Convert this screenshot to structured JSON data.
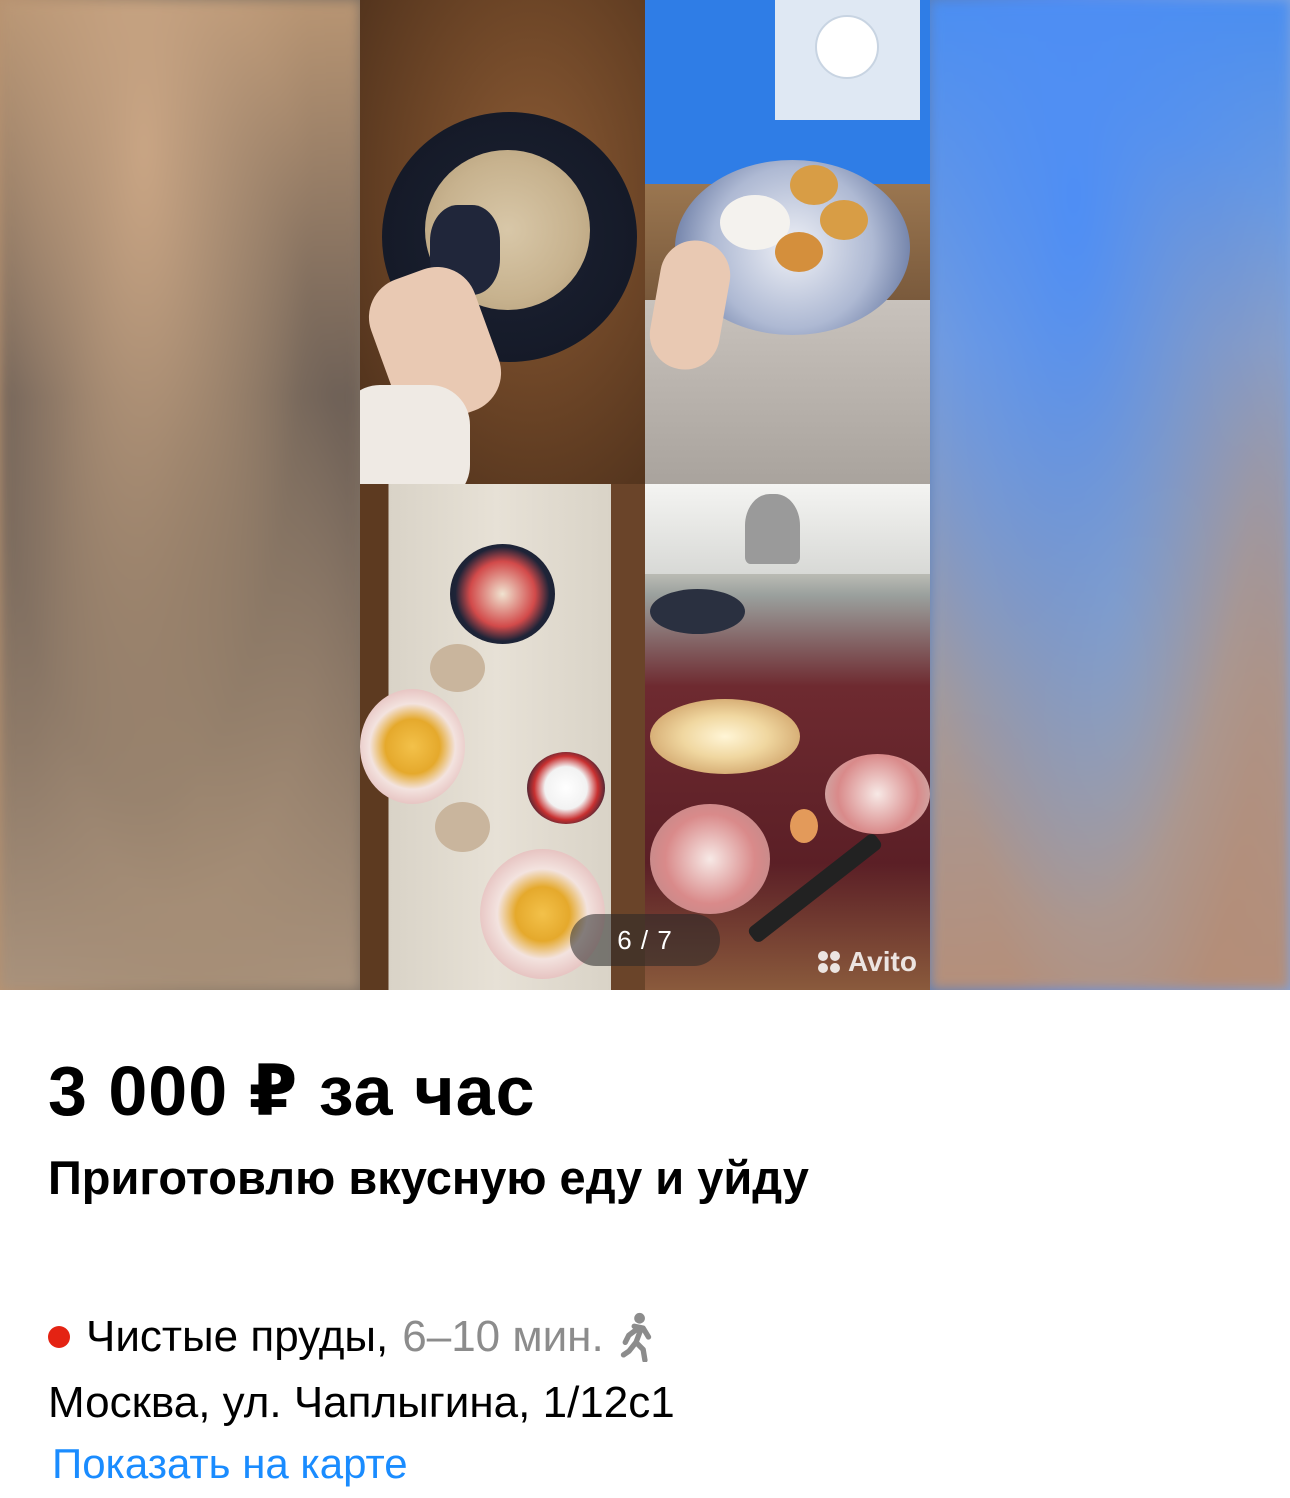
{
  "gallery": {
    "counter": "6 / 7",
    "watermark": "Avito"
  },
  "listing": {
    "price": "3 000 ₽ за час",
    "title": "Приготовлю вкусную еду и уйду"
  },
  "location": {
    "metro_station": "Чистые пруды,",
    "metro_time": "6–10 мин.",
    "metro_color": "#e42313",
    "address": "Москва, ул. Чаплыгина, 1/12с1",
    "map_link": "Показать на карте"
  },
  "colors": {
    "link": "#1a8cff"
  }
}
